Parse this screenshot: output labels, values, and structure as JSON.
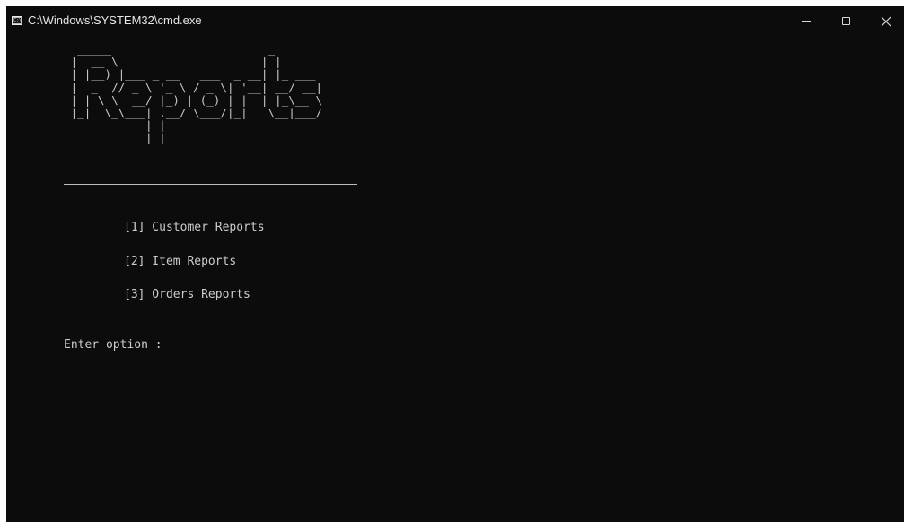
{
  "window": {
    "title": "C:\\Windows\\SYSTEM32\\cmd.exe",
    "icon": "cmd-icon"
  },
  "controls": {
    "minimize_icon": "minimize-icon",
    "maximize_icon": "maximize-icon",
    "close_icon": "close-icon"
  },
  "console": {
    "banner_ascii": "  _____                       _\n |  __ \\                     | |\n | |__) |___ _ __   ___  _ __| |_ ___\n |  _  // _ \\ '_ \\ / _ \\| '__| __/ __|\n | | \\ \\  __/ |_) | (_) | |  | |_\\__ \\\n |_|  \\_\\___| .__/ \\___/|_|   \\__|___/\n            | |\n            |_|",
    "menu": [
      {
        "label": "[1] Customer Reports"
      },
      {
        "label": "[2] Item Reports"
      },
      {
        "label": "[3] Orders Reports"
      }
    ],
    "prompt": "Enter option :"
  },
  "colors": {
    "background": "#0c0c0c",
    "text": "#cccccc"
  }
}
